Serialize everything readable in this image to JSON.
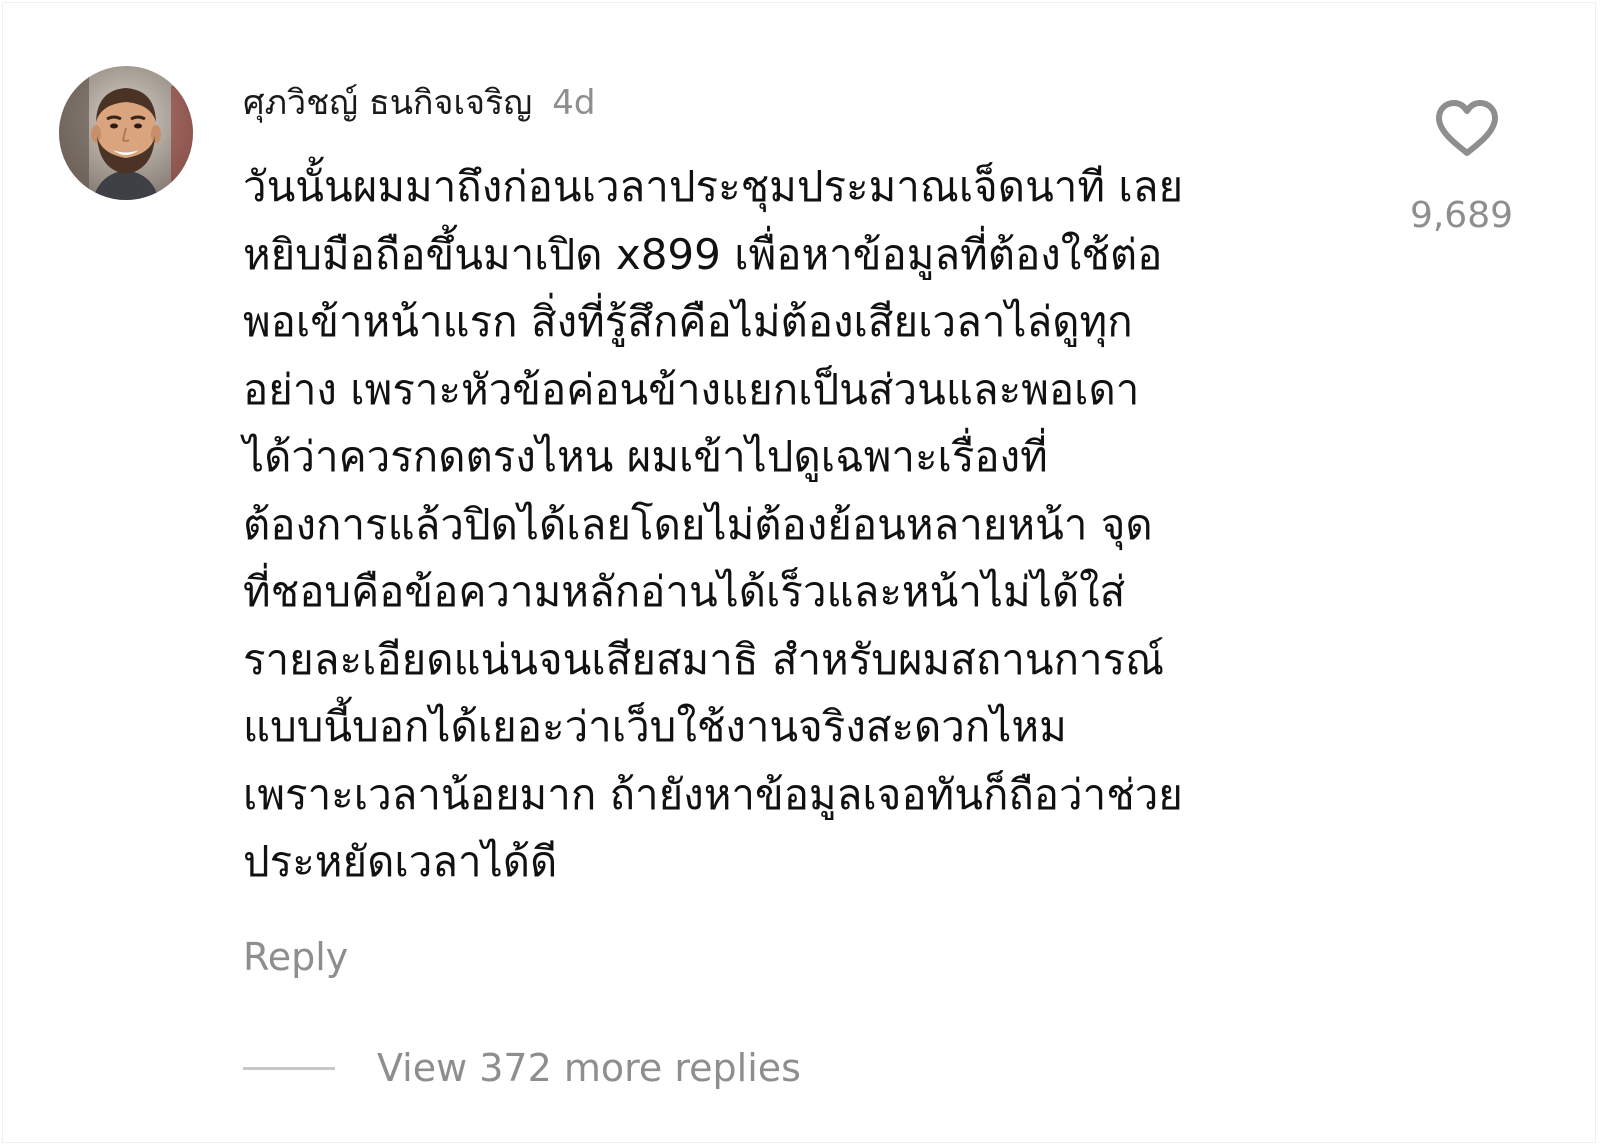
{
  "comment": {
    "author": "ศุภวิชญ์ ธนกิจเจริญ",
    "time_ago": "4d",
    "body_lines": [
      "วันนั้นผมมาถึงก่อนเวลาประชุมประมาณเจ็ดนาที เลย",
      "หยิบมือถือขึ้นมาเปิด x899 เพื่อหาข้อมูลที่ต้องใช้ต่อ",
      "พอเข้าหน้าแรก สิ่งที่รู้สึกคือไม่ต้องเสียเวลาไล่ดูทุก",
      "อย่าง เพราะหัวข้อค่อนข้างแยกเป็นส่วนและพอเดา",
      "ได้ว่าควรกดตรงไหน ผมเข้าไปดูเฉพาะเรื่องที่",
      "ต้องการแล้วปิดได้เลยโดยไม่ต้องย้อนหลายหน้า จุด",
      "ที่ชอบคือข้อความหลักอ่านได้เร็วและหน้าไม่ได้ใส่",
      "รายละเอียดแน่นจนเสียสมาธิ สำหรับผมสถานการณ์",
      "แบบนี้บอกได้เยอะว่าเว็บใช้งานจริงสะดวกไหม",
      "เพราะเวลาน้อยมาก ถ้ายังหาข้อมูลเจอทันก็ถือว่าช่วย",
      "ประหยัดเวลาได้ดี"
    ],
    "like_count": "9,689",
    "reply_label": "Reply",
    "view_replies_label": "View 372 more replies",
    "icons": {
      "like": "heart-outline-icon",
      "avatar": "user-avatar-photo"
    },
    "colors": {
      "muted_text": "#8e8e8e",
      "body_text": "#111111",
      "icon_stroke": "#8e8e8e"
    }
  }
}
